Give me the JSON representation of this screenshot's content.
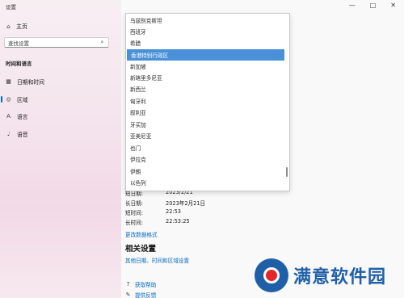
{
  "window": {
    "title": "设置",
    "controls": [
      "—",
      "□",
      "✕"
    ]
  },
  "sidebar": {
    "home_label": "主页",
    "search_placeholder": "查找设置",
    "section_title": "时间和语言",
    "items": [
      {
        "label": "日期和时间",
        "icon": "calendar-icon"
      },
      {
        "label": "区域",
        "icon": "globe-icon",
        "active": true
      },
      {
        "label": "语言",
        "icon": "language-icon"
      },
      {
        "label": "语音",
        "icon": "microphone-icon"
      }
    ]
  },
  "region_dropdown": {
    "items": [
      "乌兹别克斯坦",
      "西班牙",
      "希腊",
      "香港特别行政区",
      "新加坡",
      "新喀里多尼亚",
      "新西兰",
      "匈牙利",
      "叙利亚",
      "牙买加",
      "亚美尼亚",
      "也门",
      "伊拉克",
      "伊朗",
      "以色列"
    ],
    "selected_index": 3
  },
  "format": {
    "rows": [
      {
        "label": "短日期:",
        "value": "2023/2/21"
      },
      {
        "label": "长日期:",
        "value": "2023年2月21日"
      },
      {
        "label": "短时间:",
        "value": "22:53"
      },
      {
        "label": "长时间:",
        "value": "22:53:25"
      }
    ],
    "change_link": "更改数据格式"
  },
  "related": {
    "title": "相关设置",
    "link": "其他日期、时间和区域设置"
  },
  "help": {
    "get_help": "获取帮助",
    "feedback": "提供反馈"
  },
  "watermark": {
    "text": "满意软件园"
  }
}
